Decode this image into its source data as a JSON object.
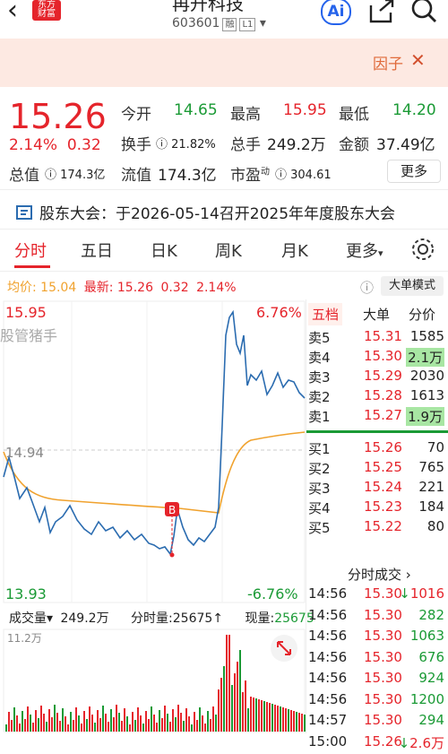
{
  "header": {
    "back": "‹",
    "logo_line1": "东方",
    "logo_line2": "财富",
    "stock_name": "再升科技",
    "code": "603601",
    "tag_rong": "融",
    "tag_level": "L1",
    "ai_label": "Ai"
  },
  "banner": {
    "text": "因子",
    "close": "✕"
  },
  "quote": {
    "price": "15.26",
    "change_pct": "2.14%",
    "change": "0.32",
    "open_label": "今开",
    "open": "14.65",
    "high_label": "最高",
    "high": "15.95",
    "low_label": "最低",
    "low": "14.20",
    "turnover_label": "换手",
    "turnover": "21.82%",
    "volume_label": "总手",
    "volume": "249.2万",
    "amount_label": "金额",
    "amount": "37.49亿",
    "mktcap_label": "总值",
    "mktcap": "174.3亿",
    "float_label": "流值",
    "float": "174.3亿",
    "pe_label": "市盈",
    "pe_sup": "动",
    "pe": "304.61",
    "more": "更多"
  },
  "announcement": "股东大会：于2026-05-14召开2025年年度股东大会",
  "tabs": [
    "分时",
    "五日",
    "日K",
    "周K",
    "月K",
    "更多"
  ],
  "chart_bar": {
    "avg_label": "均价:",
    "avg": "15.04",
    "last_label": "最新:",
    "last": "15.26",
    "chg": "0.32",
    "pct": "2.14%",
    "big_order": "大单模式"
  },
  "chart_labels": {
    "top": "15.95",
    "top_pct": "6.76%",
    "mid": "14.94",
    "bottom": "13.93",
    "bottom_pct": "-6.76%",
    "badge": "B",
    "watermark": "股管猪手"
  },
  "vol_bar": {
    "label": "成交量",
    "total": "249.2万",
    "fs_label": "分时量:",
    "fs": "25675↑",
    "now_label": "现量:",
    "now": "25675",
    "ymax": "11.2万"
  },
  "book_tabs": [
    "五档",
    "大单",
    "分价"
  ],
  "asks": [
    {
      "label": "卖5",
      "price": "15.31",
      "vol": "1585"
    },
    {
      "label": "卖4",
      "price": "15.30",
      "vol": "2.1万"
    },
    {
      "label": "卖3",
      "price": "15.29",
      "vol": "2030"
    },
    {
      "label": "卖2",
      "price": "15.28",
      "vol": "1613"
    },
    {
      "label": "卖1",
      "price": "15.27",
      "vol": "1.9万"
    }
  ],
  "bids": [
    {
      "label": "买1",
      "price": "15.26",
      "vol": "70"
    },
    {
      "label": "买2",
      "price": "15.25",
      "vol": "765"
    },
    {
      "label": "买3",
      "price": "15.24",
      "vol": "221"
    },
    {
      "label": "买4",
      "price": "15.23",
      "vol": "184"
    },
    {
      "label": "买5",
      "price": "15.22",
      "vol": "80"
    }
  ],
  "ticks_title": "分时成交",
  "ticks": [
    {
      "time": "14:56",
      "price": "15.30",
      "vol": "1016",
      "dir": "down"
    },
    {
      "time": "14:56",
      "price": "15.30",
      "vol": "282",
      "dir": ""
    },
    {
      "time": "14:56",
      "price": "15.30",
      "vol": "1063",
      "dir": ""
    },
    {
      "time": "14:56",
      "price": "15.30",
      "vol": "676",
      "dir": ""
    },
    {
      "time": "14:56",
      "price": "15.30",
      "vol": "924",
      "dir": ""
    },
    {
      "time": "14:56",
      "price": "15.30",
      "vol": "1200",
      "dir": ""
    },
    {
      "time": "14:57",
      "price": "15.30",
      "vol": "294",
      "dir": ""
    },
    {
      "time": "15:00",
      "price": "15.26",
      "vol": "2.6万",
      "dir": "down"
    }
  ],
  "colors": {
    "up": "#e5242b",
    "down": "#1a9a35",
    "avg_line": "#f0a22e",
    "price_line": "#2b6cb0"
  }
}
